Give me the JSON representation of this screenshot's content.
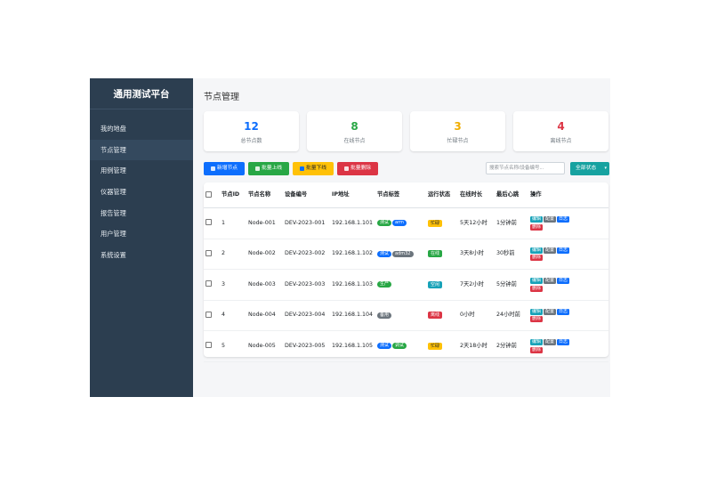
{
  "sidebar": {
    "brand": "通用测试平台",
    "items": [
      {
        "label": "我的地盘"
      },
      {
        "label": "节点管理",
        "active": true
      },
      {
        "label": "用例管理"
      },
      {
        "label": "仪器管理"
      },
      {
        "label": "报告管理"
      },
      {
        "label": "用户管理"
      },
      {
        "label": "系统设置"
      }
    ]
  },
  "header": {
    "title": "节点管理"
  },
  "stats": [
    {
      "value": "12",
      "label": "总节点数",
      "color": "#0d6efd"
    },
    {
      "value": "8",
      "label": "在线节点",
      "color": "#28a745"
    },
    {
      "value": "3",
      "label": "忙碌节点",
      "color": "#f0ad00"
    },
    {
      "value": "4",
      "label": "离线节点",
      "color": "#dc3545"
    }
  ],
  "toolbar": {
    "add_label": "新增节点",
    "online_label": "批量上线",
    "offline_label": "批量下线",
    "delete_label": "批量删除",
    "search_placeholder": "搜索节点名称/设备编号...",
    "filter_selected": "全部状态"
  },
  "colors": {
    "primary": "#0d6efd",
    "success": "#28a745",
    "warning": "#ffc107",
    "danger": "#dc3545",
    "info": "#17a2b8",
    "secondary": "#6c757d",
    "sidebar": "#2c3e50"
  },
  "table": {
    "headers": [
      "",
      "节点ID",
      "节点名称",
      "设备编号",
      "IP地址",
      "节点标签",
      "运行状态",
      "在线时长",
      "最后心跳",
      "操作"
    ],
    "action_labels": [
      "编辑",
      "配置",
      "日志",
      "删除"
    ],
    "rows": [
      {
        "id": "1",
        "name": "Node-001",
        "device": "DEV-2023-001",
        "ip": "192.168.1.101",
        "tags": [
          {
            "label": "测试",
            "color": "success"
          },
          {
            "label": "arm",
            "color": "primary"
          }
        ],
        "status": {
          "label": "忙碌",
          "color": "warning"
        },
        "uptime": "5天12小时",
        "heartbeat": "1分钟前"
      },
      {
        "id": "2",
        "name": "Node-002",
        "device": "DEV-2023-002",
        "ip": "192.168.1.102",
        "tags": [
          {
            "label": "测试",
            "color": "primary"
          },
          {
            "label": "adm32",
            "color": "secondary"
          }
        ],
        "status": {
          "label": "在线",
          "color": "success"
        },
        "uptime": "3天8小时",
        "heartbeat": "30秒前"
      },
      {
        "id": "3",
        "name": "Node-003",
        "device": "DEV-2023-003",
        "ip": "192.168.1.103",
        "tags": [
          {
            "label": "生产",
            "color": "success"
          }
        ],
        "status": {
          "label": "空闲",
          "color": "info"
        },
        "uptime": "7天2小时",
        "heartbeat": "5分钟前"
      },
      {
        "id": "4",
        "name": "Node-004",
        "device": "DEV-2023-004",
        "ip": "192.168.1.104",
        "tags": [
          {
            "label": "备用",
            "color": "secondary"
          }
        ],
        "status": {
          "label": "离线",
          "color": "danger"
        },
        "uptime": "0小时",
        "heartbeat": "24小时前"
      },
      {
        "id": "5",
        "name": "Node-005",
        "device": "DEV-2023-005",
        "ip": "192.168.1.105",
        "tags": [
          {
            "label": "测试",
            "color": "primary"
          },
          {
            "label": "调试",
            "color": "success"
          }
        ],
        "status": {
          "label": "忙碌",
          "color": "warning"
        },
        "uptime": "2天18小时",
        "heartbeat": "2分钟前"
      }
    ]
  }
}
